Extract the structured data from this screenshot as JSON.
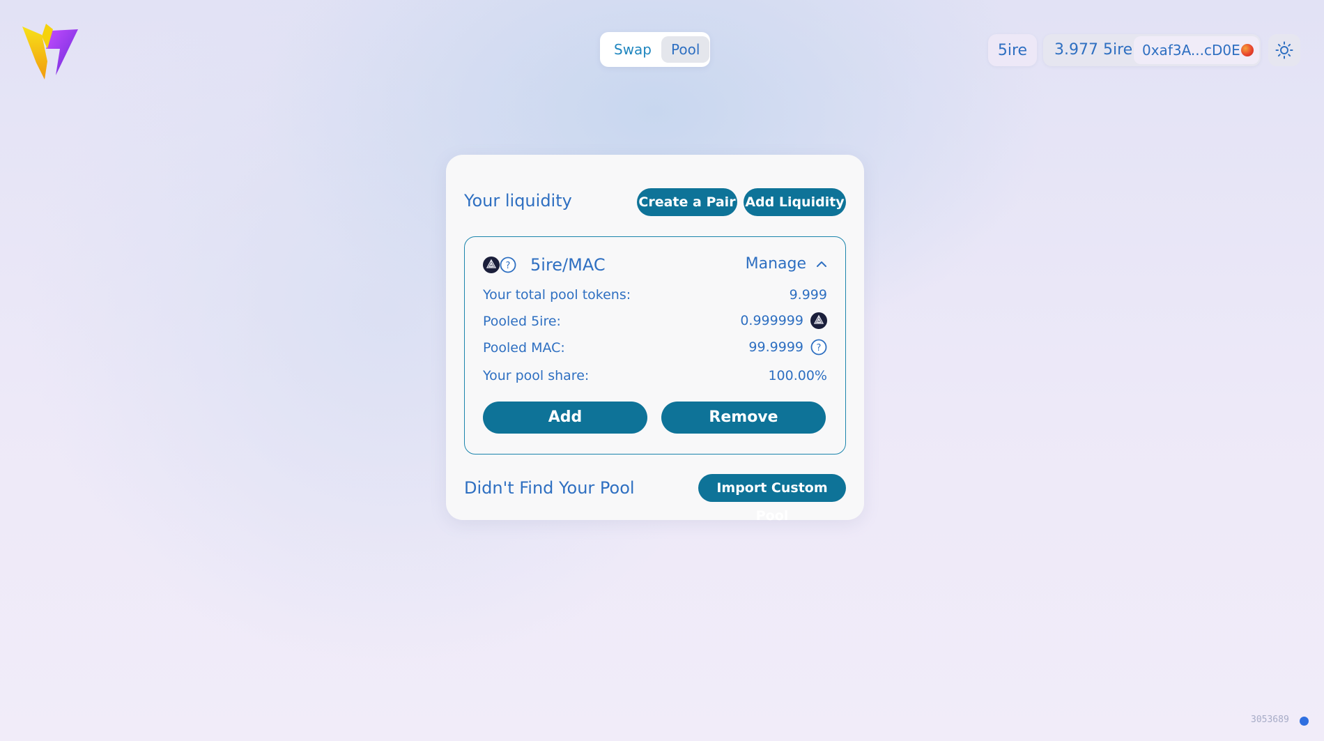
{
  "header": {
    "nav": [
      {
        "label": "Swap",
        "active": false
      },
      {
        "label": "Pool",
        "active": true
      }
    ],
    "chain_label": "5ire",
    "balance": "3.977 5ire",
    "address": "0xaf3A...cD0E",
    "logo_icon": "lightning-logo",
    "theme_icon": "sun-icon"
  },
  "liquidity": {
    "title": "Your liquidity",
    "create_pair_label": "Create a Pair",
    "add_liquidity_label": "Add Liquidity",
    "pool": {
      "pair": "5ire/MAC",
      "manage_label": "Manage",
      "rows": [
        {
          "label": "Your total pool tokens:",
          "value": "9.999"
        },
        {
          "label": "Pooled 5ire:",
          "value": "0.999999",
          "icon": "5ire-token-icon"
        },
        {
          "label": "Pooled MAC:",
          "value": "99.9999",
          "icon": "unknown-token-icon"
        },
        {
          "label": "Your pool share:",
          "value": "100.00%"
        }
      ],
      "add_label": "Add",
      "remove_label": "Remove"
    },
    "not_found_label": "Didn't Find Your Pool",
    "import_label": "Import Custom Pool"
  },
  "footer": {
    "block_number": "3053689"
  },
  "colors": {
    "accent": "#0e7398",
    "text": "#2e6fc1",
    "status": "#2f6fe0"
  }
}
